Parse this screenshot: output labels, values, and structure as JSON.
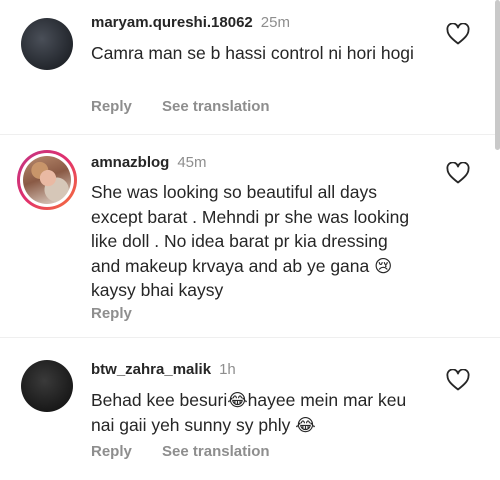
{
  "comments": [
    {
      "username": "maryam.qureshi.18062",
      "time": "25m",
      "text": "Camra man se b hassi control ni hori hogi",
      "reply_label": "Reply",
      "translate_label": "See translation"
    },
    {
      "username": "amnazblog",
      "time": "45m",
      "text": "She was looking so beautiful all days except barat . Mehndi pr she was looking like doll . No idea barat pr kia dressing and makeup krvaya and ab ye gana 😢 kaysy bhai kaysy",
      "reply_label": "Reply"
    },
    {
      "username": "btw_zahra_malik",
      "time": "1h",
      "text": "Behad kee besuri😂hayee mein mar keu nai gaii yeh sunny sy phly 😂",
      "reply_label": "Reply",
      "translate_label": "See translation"
    }
  ],
  "icons": {
    "like": "heart-outline-icon"
  },
  "colors": {
    "text": "#262626",
    "secondary": "#8e8e8e",
    "story_ring": "#e1306c"
  }
}
